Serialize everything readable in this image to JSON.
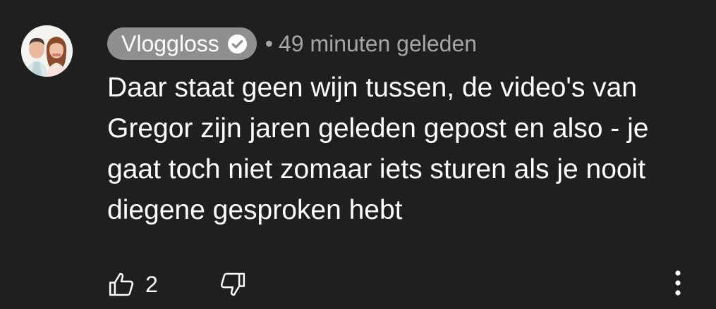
{
  "comment": {
    "author": "Vloggloss",
    "separator": "•",
    "timestamp": "49 minuten geleden",
    "text": "Daar staat geen wijn tussen, de video's van Gregor zijn jaren geleden gepost en also - je gaat toch niet zomaar iets sturen als je nooit diegene gesproken hebt",
    "like_count": "2"
  },
  "colors": {
    "background": "#1f1f1f",
    "author_chip": "#8f8f8f",
    "text": "#ffffff",
    "meta_text": "#a6a6a6"
  },
  "icons": {
    "avatar": "avatar",
    "verified": "verified-check-icon",
    "like": "thumbs-up-icon",
    "dislike": "thumbs-down-icon",
    "more": "more-vertical-icon"
  }
}
